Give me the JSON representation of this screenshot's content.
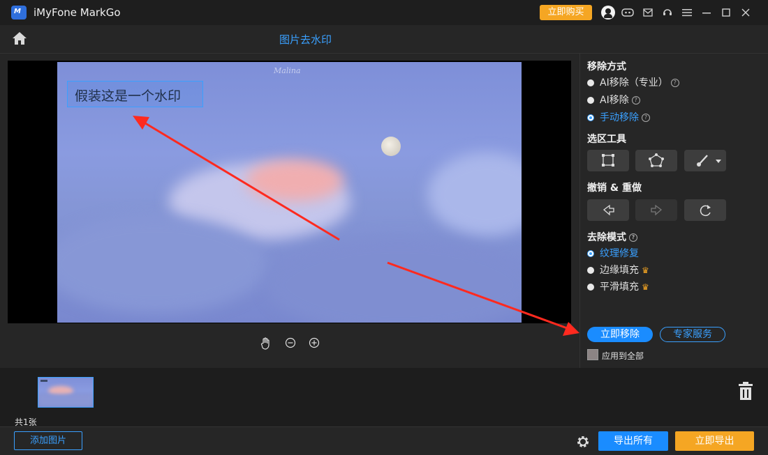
{
  "titlebar": {
    "app_name": "iMyFone MarkGo",
    "logo_text": "M",
    "buy_label": "立即购买",
    "icons": [
      "user-icon",
      "discord-icon",
      "mail-icon",
      "support-icon",
      "menu-icon",
      "minimize-icon",
      "maximize-icon",
      "close-icon"
    ]
  },
  "nav": {
    "page_title": "图片去水印"
  },
  "canvas": {
    "signature": "Malina",
    "watermark_text": "假装这是一个水印"
  },
  "panel": {
    "remove_method_title": "移除方式",
    "remove_methods": [
      {
        "label": "AI移除（专业）",
        "selected": false
      },
      {
        "label": "AI移除",
        "selected": false
      },
      {
        "label": "手动移除",
        "selected": true
      }
    ],
    "select_tool_title": "选区工具",
    "undo_redo_title": "撤销 & 重做",
    "removal_mode_title": "去除模式",
    "removal_modes": [
      {
        "label": "纹理修复",
        "selected": true,
        "premium": false
      },
      {
        "label": "边缘填充",
        "selected": false,
        "premium": true
      },
      {
        "label": "平滑填充",
        "selected": false,
        "premium": true
      }
    ],
    "remove_now_label": "立即移除",
    "expert_service_label": "专家服务",
    "apply_all_label": "应用到全部",
    "apply_all_checked": false
  },
  "strip": {
    "count_label": "共1张"
  },
  "bottombar": {
    "add_image_label": "添加图片",
    "export_all_label": "导出所有",
    "export_now_label": "立即导出"
  },
  "colors": {
    "accent": "#1a8cff",
    "premium": "#f5a623",
    "annotation_arrow": "#ff2a1f"
  }
}
